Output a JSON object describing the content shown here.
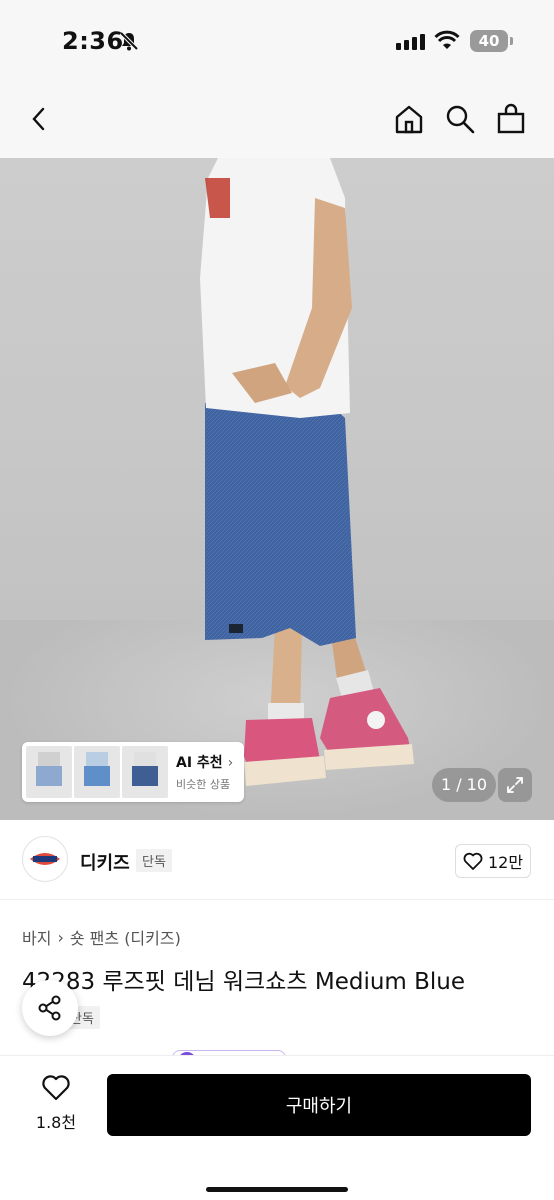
{
  "status_bar": {
    "time": "2:36",
    "battery": "40",
    "icons": [
      "bell-muted-icon",
      "signal-icon",
      "wifi-icon",
      "battery-icon"
    ]
  },
  "nav": {
    "icons": [
      "back-icon",
      "home-icon",
      "search-icon",
      "shopping-bag-icon"
    ]
  },
  "hero": {
    "page_indicator": "1 / 10",
    "ai_card": {
      "title": "AI 추천",
      "subtitle": "비슷한 상품"
    }
  },
  "brand": {
    "name": "디키즈",
    "tag": "단독",
    "likes": "12만"
  },
  "product": {
    "breadcrumb": [
      "바지",
      "숏 팬츠 (디키즈)"
    ],
    "title": "42283 루즈핏 데님 워크쇼츠 Medium Blue",
    "tag": "단독"
  },
  "bottom": {
    "wish_count": "1.8천",
    "buy_label": "구매하기"
  },
  "colors": {
    "accent": "#000000",
    "denim": "#3f63a0",
    "pink": "#d9577f",
    "purple": "#7b4ddb"
  }
}
